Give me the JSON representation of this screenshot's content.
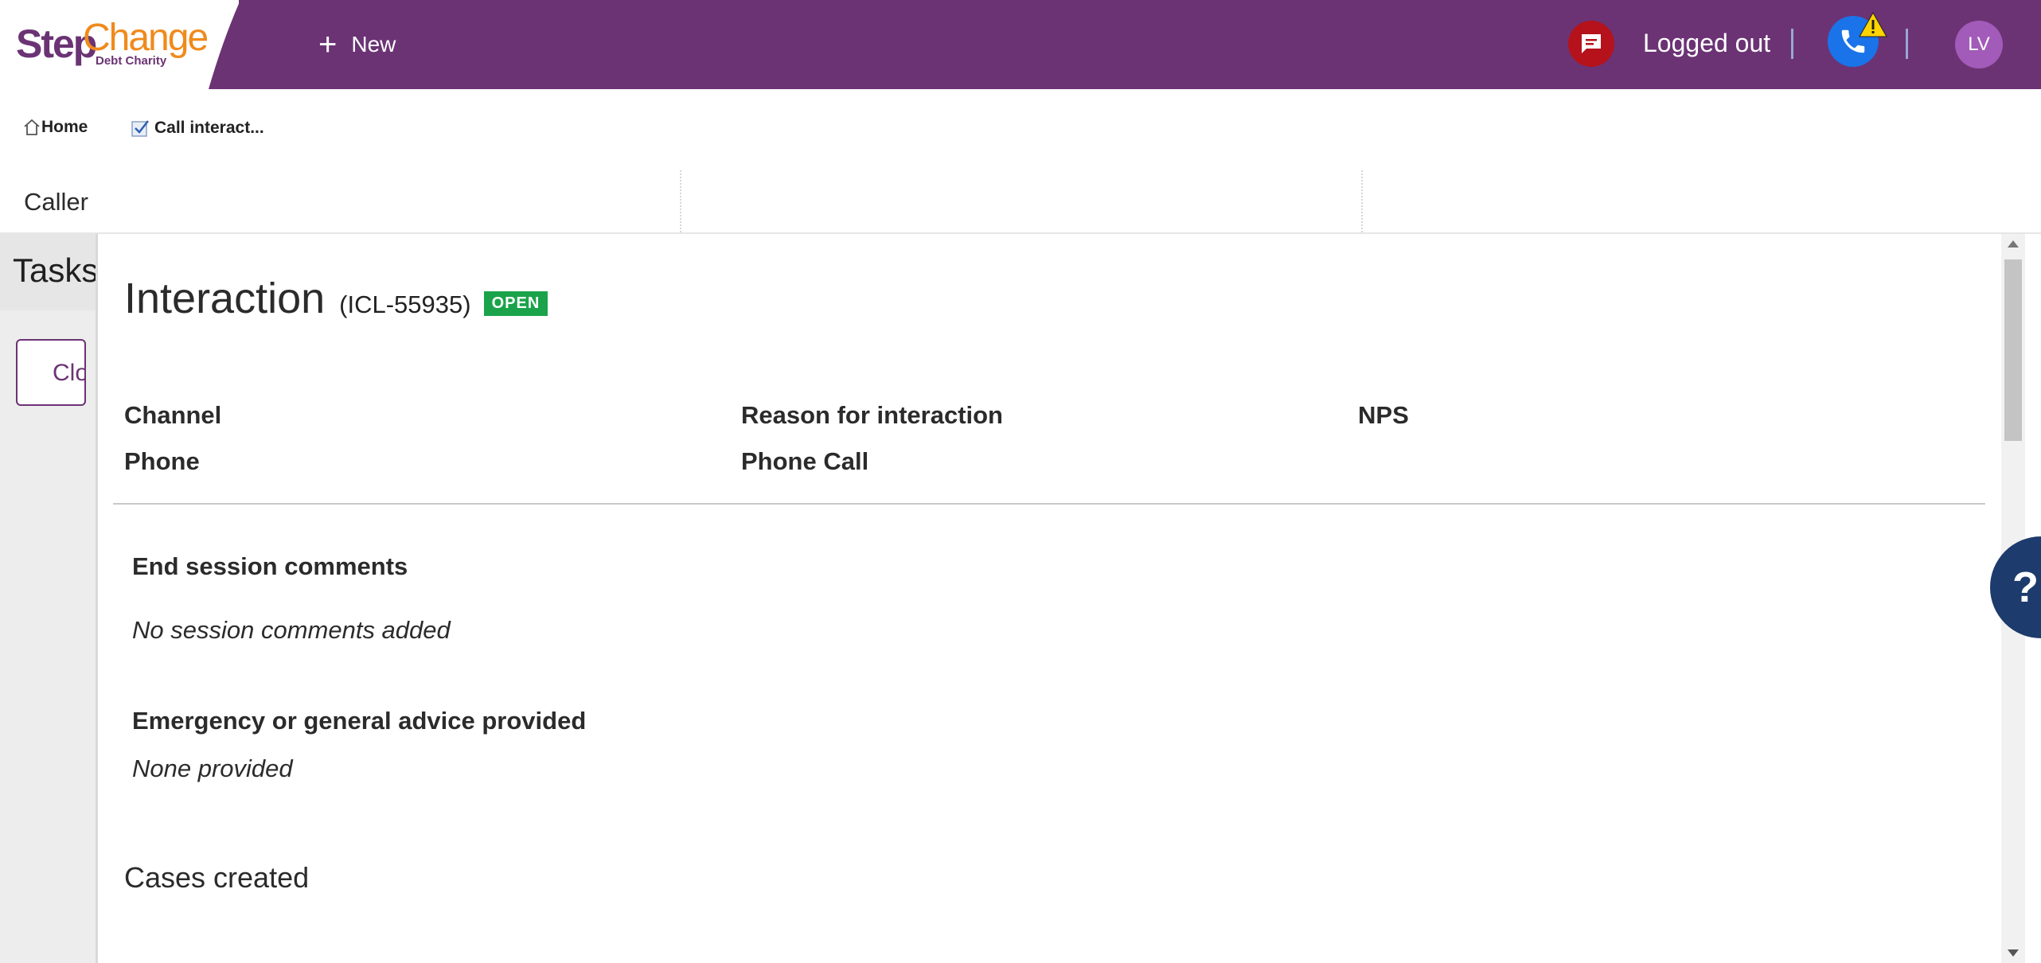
{
  "brand": {
    "logo_part1": "Step",
    "logo_part2": "Change",
    "logo_subtitle": "Debt Charity"
  },
  "topbar": {
    "new_label": "New",
    "status_text": "Logged out",
    "avatar_initials": "LV",
    "colors": {
      "bar": "#6b3374",
      "chat": "#b5121b",
      "phone": "#1a73e8",
      "avatar": "#a25bb9"
    }
  },
  "breadcrumbs": [
    {
      "label": "Home",
      "icon": "home-icon"
    },
    {
      "label": "Call interact...",
      "icon": "checkbox-icon"
    }
  ],
  "caller": {
    "label": "Caller"
  },
  "sidebar": {
    "title": "Tasks",
    "close_button": "Close"
  },
  "interaction": {
    "title": "Interaction",
    "id": "(ICL-55935)",
    "status": "OPEN",
    "status_color": "#1aa34a",
    "fields": [
      {
        "label": "Channel",
        "value": "Phone"
      },
      {
        "label": "Reason for interaction",
        "value": "Phone Call"
      },
      {
        "label": "NPS",
        "value": ""
      }
    ],
    "end_session_heading": "End session comments",
    "end_session_value": "No session comments added",
    "advice_heading": "Emergency or general advice provided",
    "advice_value": "None provided",
    "cases_heading": "Cases created"
  },
  "help": {
    "label": "?"
  }
}
